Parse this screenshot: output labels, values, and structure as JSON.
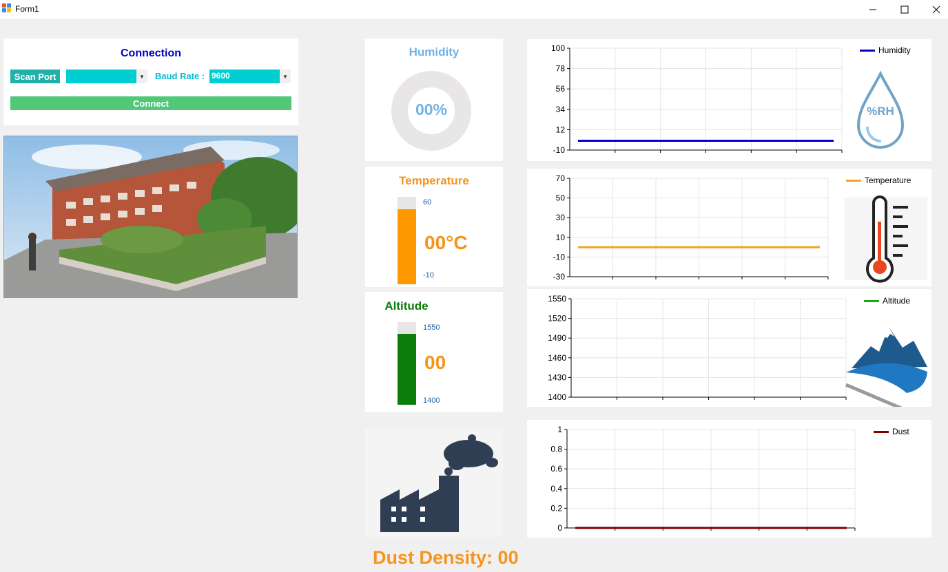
{
  "window": {
    "title": "Form1",
    "minimize_icon": "minimize-icon",
    "maximize_icon": "maximize-icon",
    "close_icon": "close-icon"
  },
  "connection": {
    "title": "Connection",
    "scan_port_label": "Scan Port",
    "port_value": "",
    "baud_rate_label": "Baud Rate :",
    "baud_rate_value": "9600",
    "connect_label": "Connect"
  },
  "humidity": {
    "title": "Humidity",
    "value": "00%",
    "percent": 0,
    "color": "#6fb3e6"
  },
  "temperature": {
    "title": "Temperature",
    "value": "00°C",
    "max_label": "60",
    "min_label": "-10",
    "fill_fraction": 0.86,
    "color": "#ff9900"
  },
  "altitude": {
    "title": "Altitude",
    "value": "00",
    "max_label": "1550",
    "min_label": "1400",
    "fill_fraction": 0.86,
    "color": "#0a7d0a"
  },
  "dust": {
    "label": "Dust Density:",
    "value": "00"
  },
  "charts": [
    {
      "name": "humidity-chart",
      "legend": "Humidity",
      "color": "#0000cd",
      "yticks": [
        "100",
        "78",
        "56",
        "34",
        "12",
        "-10"
      ],
      "series_value_y": 0,
      "ylim": [
        -10,
        100
      ],
      "icon": "humidity-drop-icon"
    },
    {
      "name": "temperature-chart",
      "legend": "Temperature",
      "color": "#f5a020",
      "yticks": [
        "70",
        "50",
        "30",
        "10",
        "-10",
        "-30"
      ],
      "series_value_y": 0,
      "ylim": [
        -30,
        70
      ],
      "icon": "thermometer-icon"
    },
    {
      "name": "altitude-chart",
      "legend": "Altitude",
      "color": "#1aab1a",
      "yticks": [
        "1550",
        "1520",
        "1490",
        "1460",
        "1430",
        "1400"
      ],
      "series_value_y": null,
      "ylim": [
        1400,
        1550
      ],
      "icon": "mountain-icon"
    },
    {
      "name": "dust-chart",
      "legend": "Dust",
      "color": "#800000",
      "yticks": [
        "1",
        "0.8",
        "0.6",
        "0.4",
        "0.2",
        "0"
      ],
      "series_value_y": 0,
      "ylim": [
        0,
        1
      ],
      "icon": ""
    }
  ],
  "photo": {
    "icon": "campus-building-photo"
  },
  "factory": {
    "icon": "factory-pollution-icon"
  }
}
